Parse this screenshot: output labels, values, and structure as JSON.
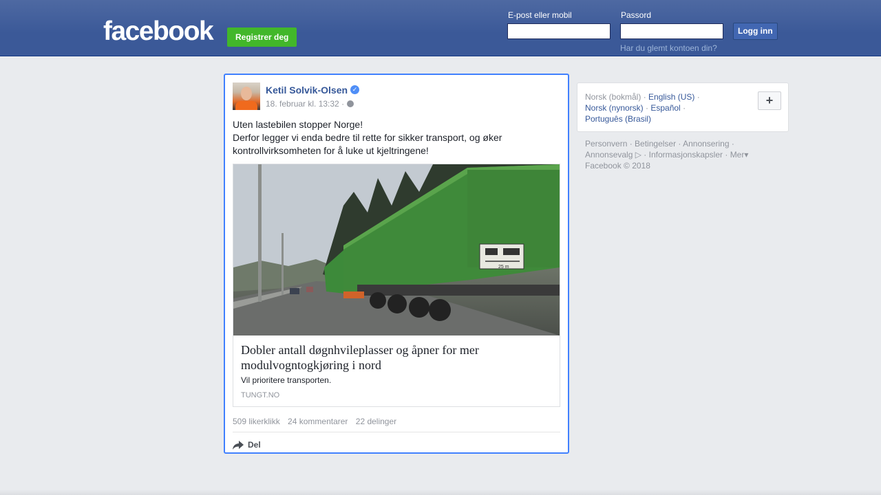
{
  "header": {
    "logo": "facebook",
    "register_label": "Registrer deg",
    "email_label": "E-post eller mobil",
    "email_value": "",
    "password_label": "Passord",
    "password_value": "",
    "login_label": "Logg inn",
    "forgot_label": "Har du glemt kontoen din?"
  },
  "post": {
    "author": "Ketil Solvik-Olsen",
    "timestamp": "18. februar kl. 13:32 ·",
    "text_lines": [
      "Uten lastebilen stopper Norge!",
      "Derfor legger vi enda bedre til rette for sikker transport, og øker",
      "kontrollvirksomheten for å luke ut kjeltringene!"
    ],
    "link": {
      "title": "Dobler antall døgnhvileplasser og åpner for mer modulvogntogkjøring i nord",
      "description": "Vil prioritere transporten.",
      "domain": "TUNGT.NO",
      "image_sign_text": "25 m"
    },
    "likes": "509 likerklikk",
    "comments": "24 kommentarer",
    "shares": "22 delinger",
    "share_label": "Del"
  },
  "sidebar": {
    "languages": {
      "current": "Norsk (bokmål)",
      "items": [
        "English (US)",
        "Norsk (nynorsk)",
        "Español",
        "Português (Brasil)"
      ]
    },
    "footer_links": [
      "Personvern",
      "Betingelser",
      "Annonsering",
      "Annonsevalg",
      "Informasjonskapsler",
      "Mer"
    ],
    "copyright": "Facebook © 2018"
  },
  "colors": {
    "brand_blue": "#3b5998",
    "register_green": "#42b72a",
    "link_blue": "#365899",
    "focus_border": "#4080ff",
    "truck_green": "#3f8a3a"
  }
}
